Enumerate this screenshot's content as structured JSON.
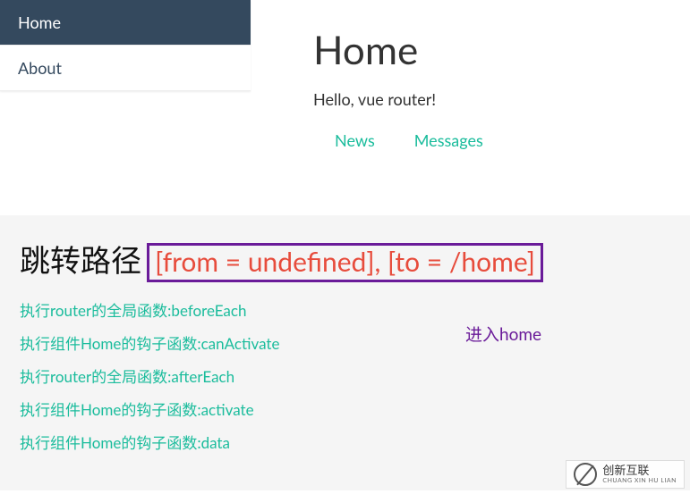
{
  "sidebar": {
    "items": [
      {
        "label": "Home",
        "active": true
      },
      {
        "label": "About",
        "active": false
      }
    ]
  },
  "card": {
    "title": "Home",
    "greeting": "Hello, vue router!",
    "tabs": [
      {
        "label": "News"
      },
      {
        "label": "Messages"
      }
    ]
  },
  "lower": {
    "headline": "跳转路径",
    "route_text": "[from = undefined], [to = /home]",
    "enter_label": "进入home",
    "logs": [
      "执行router的全局函数:beforeEach",
      "执行组件Home的钩子函数:canActivate",
      "执行router的全局函数:afterEach",
      "执行组件Home的钩子函数:activate",
      "执行组件Home的钩子函数:data"
    ]
  },
  "watermark": {
    "brand": "创新互联",
    "sub": "CHUANG XIN HU LIAN"
  }
}
